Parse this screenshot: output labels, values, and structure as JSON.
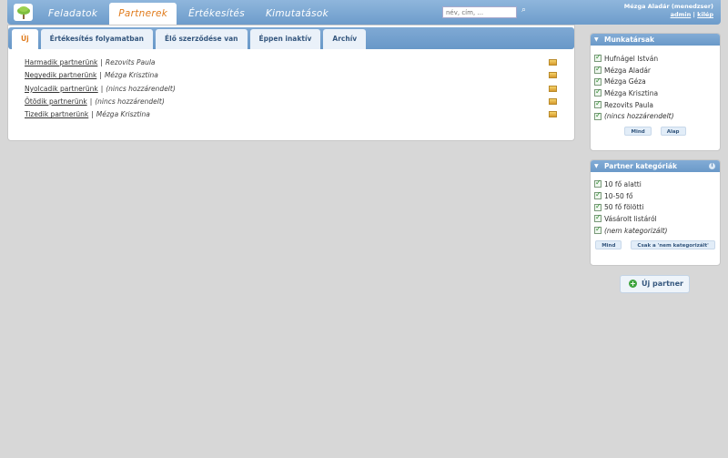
{
  "nav": {
    "items": [
      {
        "label": "Feladatok",
        "active": false
      },
      {
        "label": "Partnerek",
        "active": true
      },
      {
        "label": "Értékesítés",
        "active": false
      },
      {
        "label": "Kimutatások",
        "active": false
      }
    ]
  },
  "search": {
    "placeholder": "név, cím, ..."
  },
  "user": {
    "name": "Mézga Aladár (menedzser)",
    "admin_link": "admin",
    "separator": "|",
    "logout_link": "kilép"
  },
  "tabs": [
    {
      "label": "Új",
      "active": true
    },
    {
      "label": "Értékesítés folyamatban",
      "active": false
    },
    {
      "label": "Élő szerződése van",
      "active": false
    },
    {
      "label": "Éppen inaktív",
      "active": false
    },
    {
      "label": "Archív",
      "active": false
    }
  ],
  "partners": [
    {
      "name": "Harmadik partnerünk",
      "assignee": "Rezovits Paula"
    },
    {
      "name": "Negyedik partnerünk",
      "assignee": "Mézga Krisztina"
    },
    {
      "name": "Nyolcadik partnerünk",
      "assignee": "(nincs hozzárendelt)"
    },
    {
      "name": "Ötödik partnerünk",
      "assignee": "(nincs hozzárendelt)"
    },
    {
      "name": "Tizedik partnerünk",
      "assignee": "Mézga Krisztina"
    }
  ],
  "list_separator": "|",
  "staff_panel": {
    "title": "Munkatársak",
    "items": [
      {
        "label": "Hufnágel István",
        "checked": true
      },
      {
        "label": "Mézga Aladár",
        "checked": true
      },
      {
        "label": "Mézga Géza",
        "checked": true
      },
      {
        "label": "Mézga Krisztina",
        "checked": true
      },
      {
        "label": "Rezovits Paula",
        "checked": true
      },
      {
        "label": "(nincs hozzárendelt)",
        "checked": true
      }
    ],
    "btn_all": "Mind",
    "btn_default": "Alap"
  },
  "category_panel": {
    "title": "Partner kategóriák",
    "items": [
      {
        "label": "10 fő alatti",
        "checked": true
      },
      {
        "label": "10-50 fő",
        "checked": true
      },
      {
        "label": "50 fő fölötti",
        "checked": true
      },
      {
        "label": "Vásárolt listáról",
        "checked": true
      },
      {
        "label": "(nem kategorizált)",
        "checked": true
      }
    ],
    "btn_all": "Mind",
    "btn_only": "Csak a 'nem kategorizált'"
  },
  "new_partner_label": "Új partner"
}
